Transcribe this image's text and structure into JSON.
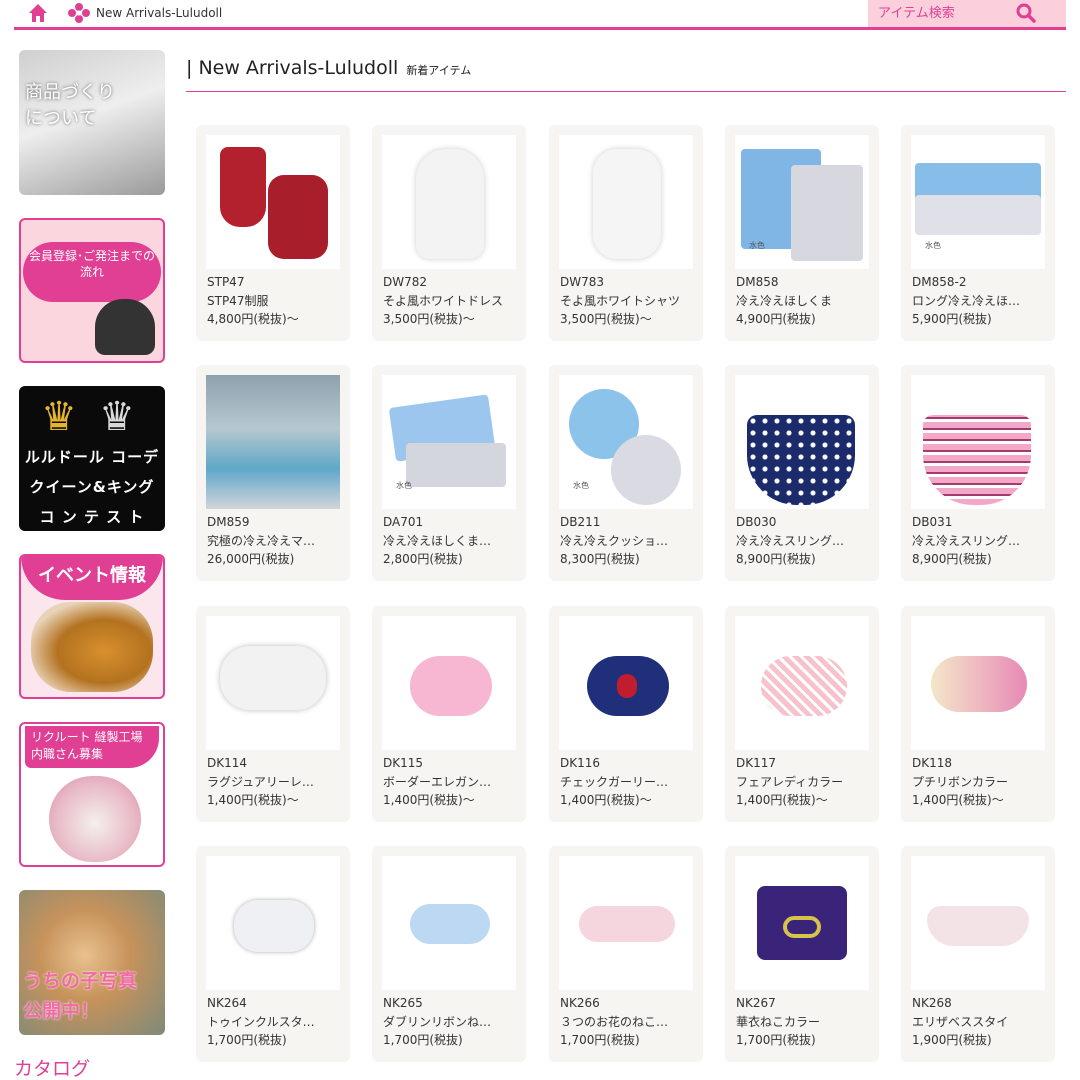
{
  "header": {
    "breadcrumb": "New Arrivals-Luludoll",
    "search_placeholder": "アイテム検索",
    "home_icon": "home-icon",
    "search_icon": "search-icon",
    "accent": "#e03f94"
  },
  "sidebar": {
    "banner1_text": "商品づくり\nについて",
    "banner2_text": "会員登録･ご発注までの\n流れ",
    "banner3_line1": "ルルドール コーデ",
    "banner3_line2": "クイーン&キング",
    "banner3_line3": "コ ン テ ス ト",
    "banner4_text": "イベント情報",
    "banner5_text": "リクルート 縫製工場\n内職さん募集",
    "banner6_text": "うちの子写真\n公開中！",
    "catalog_label": "カタログ"
  },
  "main": {
    "title": "| New Arrivals-Luludoll",
    "subtitle": "新着アイテム"
  },
  "products": [
    {
      "code": "STP47",
      "name": "STP47制服",
      "price": "4,800円(税抜)〜"
    },
    {
      "code": "DW782",
      "name": "そよ風ホワイトドレス",
      "price": "3,500円(税抜)〜"
    },
    {
      "code": "DW783",
      "name": "そよ風ホワイトシャツ",
      "price": "3,500円(税抜)〜"
    },
    {
      "code": "DM858",
      "name": "冷え冷えほしくま",
      "price": "4,900円(税抜)",
      "tag": "水色"
    },
    {
      "code": "DM858-2",
      "name": "ロング冷え冷えほ…",
      "price": "5,900円(税抜)",
      "tag": "水色"
    },
    {
      "code": "DM859",
      "name": "究極の冷え冷えマ…",
      "price": "26,000円(税抜)"
    },
    {
      "code": "DA701",
      "name": "冷え冷えほしくま…",
      "price": "2,800円(税抜)",
      "tag": "水色"
    },
    {
      "code": "DB211",
      "name": "冷え冷えクッショ…",
      "price": "8,300円(税抜)",
      "tag": "水色"
    },
    {
      "code": "DB030",
      "name": "冷え冷えスリング…",
      "price": "8,900円(税抜)"
    },
    {
      "code": "DB031",
      "name": "冷え冷えスリング…",
      "price": "8,900円(税抜)"
    },
    {
      "code": "DK114",
      "name": "ラグジュアリーレ…",
      "price": "1,400円(税抜)〜"
    },
    {
      "code": "DK115",
      "name": "ボーダーエレガン…",
      "price": "1,400円(税抜)〜"
    },
    {
      "code": "DK116",
      "name": "チェックガーリー…",
      "price": "1,400円(税抜)〜"
    },
    {
      "code": "DK117",
      "name": "フェアレディカラー",
      "price": "1,400円(税抜)〜"
    },
    {
      "code": "DK118",
      "name": "プチリボンカラー",
      "price": "1,400円(税抜)〜"
    },
    {
      "code": "NK264",
      "name": "トゥインクルスタ…",
      "price": "1,700円(税抜)"
    },
    {
      "code": "NK265",
      "name": "ダブリンリボンね…",
      "price": "1,700円(税抜)"
    },
    {
      "code": "NK266",
      "name": "３つのお花のねこ…",
      "price": "1,700円(税抜)"
    },
    {
      "code": "NK267",
      "name": "華衣ねこカラー",
      "price": "1,700円(税抜)"
    },
    {
      "code": "NK268",
      "name": "エリザベススタイ",
      "price": "1,900円(税抜)"
    }
  ]
}
